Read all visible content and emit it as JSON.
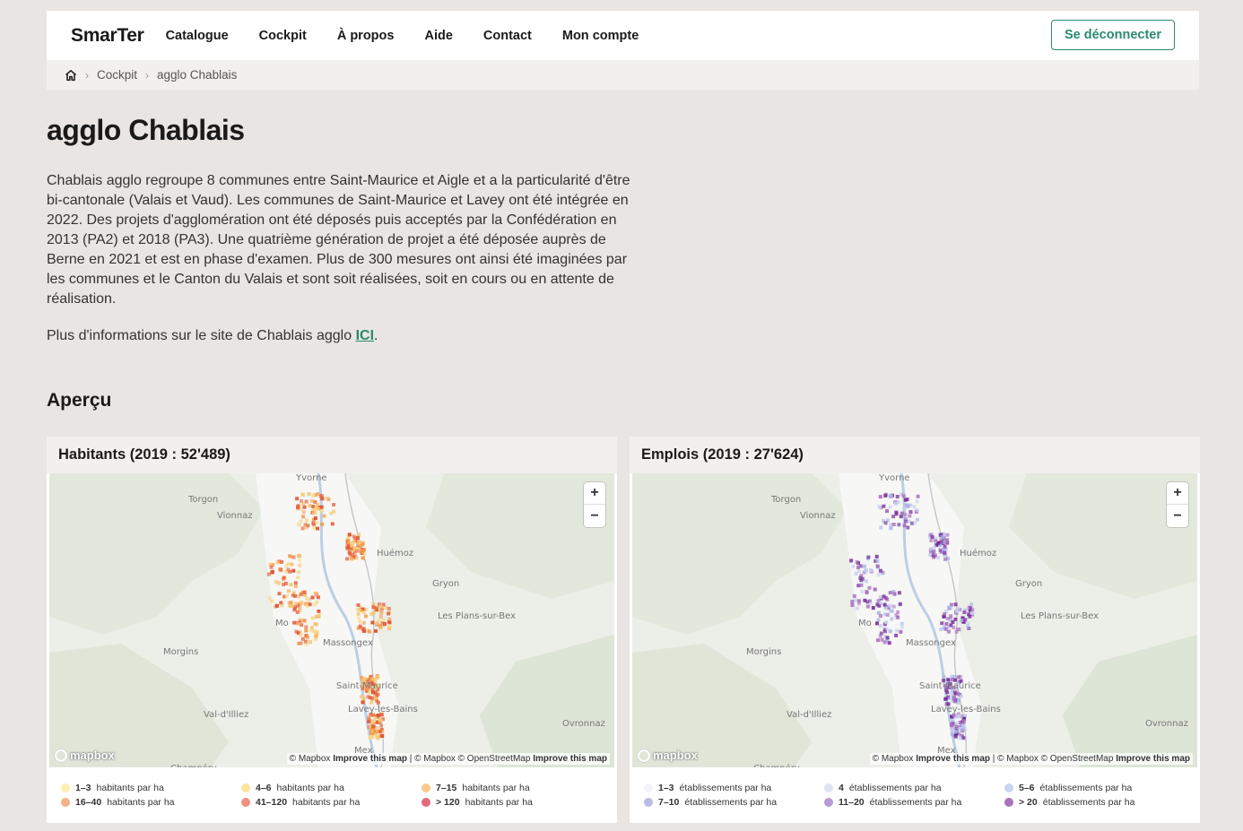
{
  "header": {
    "brand": "SmarTer",
    "nav": [
      "Catalogue",
      "Cockpit",
      "À propos",
      "Aide",
      "Contact",
      "Mon compte"
    ],
    "logout_label": "Se déconnecter"
  },
  "breadcrumb": {
    "items": [
      "Cockpit",
      "agglo Chablais"
    ]
  },
  "page": {
    "title": "agglo Chablais",
    "intro": "Chablais agglo regroupe 8 communes entre Saint-Maurice et Aigle et a la particularité d'être bi-cantonale (Valais et Vaud). Les communes de Saint-Maurice et Lavey ont été intégrée en 2022. Des projets d'agglomération ont été déposés puis acceptés par la Confédération en 2013 (PA2) et 2018 (PA3). Une quatrième génération de projet a été déposée auprès de Berne en 2021 et est en phase d'examen. Plus de 300 mesures ont ainsi été imaginées par les communes et le Canton du Valais et sont soit réalisées, soit en cours ou en attente de réalisation.",
    "more_prefix": "Plus d'informations sur le site de Chablais agglo ",
    "more_link": "ICI",
    "more_suffix": ".",
    "section_title": "Aperçu"
  },
  "map_common": {
    "zoom_in": "+",
    "zoom_out": "−",
    "logo": "mapbox",
    "attr_1": "© Mapbox",
    "attr_improve": "Improve this map",
    "attr_2": "| © Mapbox © OpenStreetMap",
    "places": [
      "Yvorne",
      "Torgon",
      "Vionnaz",
      "Huémoz",
      "Gryon",
      "Les Plans-sur-Bex",
      "Morgins",
      "Mo",
      "Massongex",
      "Saint-Maurice",
      "Lavey-les-Bains",
      "Val-d'Illiez",
      "Ovronnaz",
      "Mex",
      "Champéry"
    ]
  },
  "cards": {
    "habitants": {
      "title": "Habitants (2019 : 52'489)",
      "legend": [
        {
          "range": "1–3",
          "label": "habitants par ha",
          "color": "#fdf0b0"
        },
        {
          "range": "4–6",
          "label": "habitants par ha",
          "color": "#fde2a0"
        },
        {
          "range": "7–15",
          "label": "habitants par ha",
          "color": "#f9c98a"
        },
        {
          "range": "16–40",
          "label": "habitants par ha",
          "color": "#f5b187"
        },
        {
          "range": "41–120",
          "label": "habitants par ha",
          "color": "#ef8f80"
        },
        {
          "range": "> 120",
          "label": "habitants par ha",
          "color": "#e06a7c"
        }
      ]
    },
    "emplois": {
      "title": "Emplois (2019 : 27'624)",
      "legend": [
        {
          "range": "1–3",
          "label": "établissements par ha",
          "color": "#f3f3fb"
        },
        {
          "range": "4",
          "label": "établissements par ha",
          "color": "#dde4f5"
        },
        {
          "range": "5–6",
          "label": "établissements par ha",
          "color": "#c8d4f0"
        },
        {
          "range": "7–10",
          "label": "établissements par ha",
          "color": "#b9bde6"
        },
        {
          "range": "11–20",
          "label": "établissements par ha",
          "color": "#b79ad8"
        },
        {
          "range": "> 20",
          "label": "établissements par ha",
          "color": "#a773bd"
        }
      ]
    }
  },
  "colors": {
    "accent": "#2a8a6e",
    "heat": "#e8643a",
    "jobs": "#8a3ea8"
  }
}
